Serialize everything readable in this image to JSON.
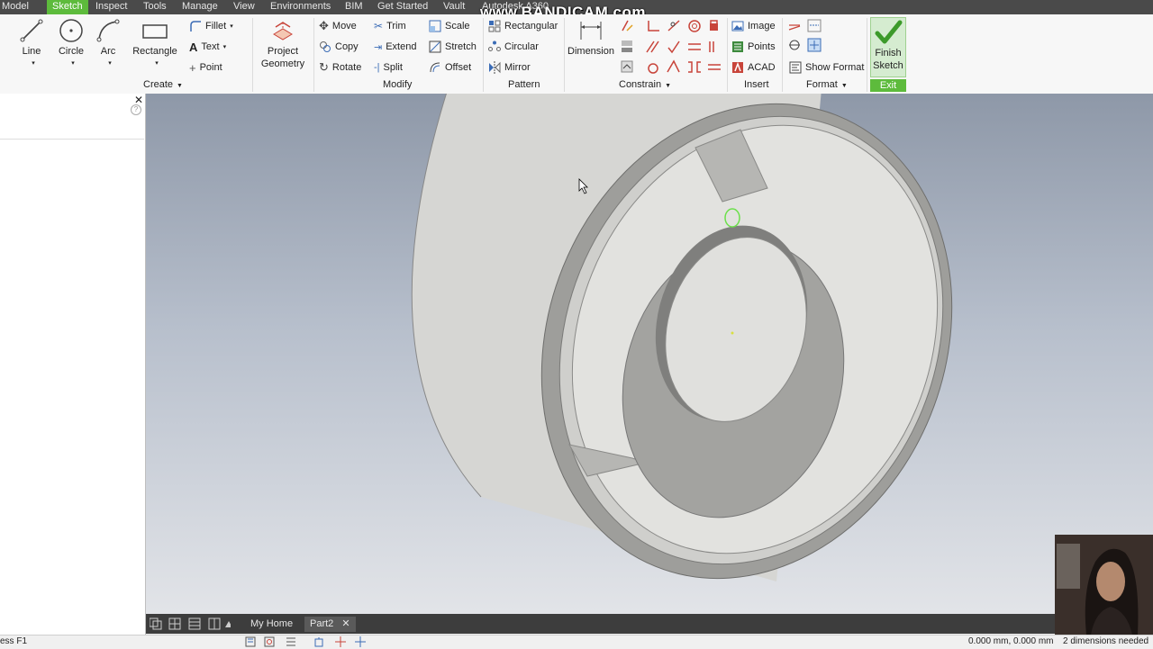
{
  "menubar": {
    "items": [
      "Model",
      "Sketch",
      "Inspect",
      "Tools",
      "Manage",
      "View",
      "Environments",
      "BIM",
      "Get Started",
      "Vault",
      "Autodesk A360"
    ],
    "active": "Sketch"
  },
  "watermark": "www.BANDICAM.com",
  "ribbon": {
    "create": {
      "line": "Line",
      "circle": "Circle",
      "arc": "Arc",
      "rectangle": "Rectangle",
      "fillet": "Fillet",
      "text": "Text",
      "point": "Point",
      "label": "Create"
    },
    "project_geometry": [
      "Project",
      "Geometry"
    ],
    "modify": {
      "move": "Move",
      "copy": "Copy",
      "rotate": "Rotate",
      "trim": "Trim",
      "extend": "Extend",
      "split": "Split",
      "scale": "Scale",
      "stretch": "Stretch",
      "offset": "Offset",
      "label": "Modify"
    },
    "pattern": {
      "rectangular": "Rectangular",
      "circular": "Circular",
      "mirror": "Mirror",
      "label": "Pattern"
    },
    "constrain": {
      "dimension": "Dimension",
      "label": "Constrain"
    },
    "insert": {
      "image": "Image",
      "points": "Points",
      "acad": "ACAD",
      "label": "Insert"
    },
    "format": {
      "show_format": "Show Format",
      "label": "Format"
    },
    "exit": {
      "finish": [
        "Finish",
        "Sketch"
      ],
      "label": "Exit"
    }
  },
  "tabs": {
    "home": "My Home",
    "part": "Part2",
    "close": "✕"
  },
  "status": {
    "left": "ess F1",
    "coords": "0.000 mm, 0.000 mm",
    "dims": "2 dimensions needed"
  },
  "colors": {
    "accent": "#5dbb3c",
    "menubar": "#4a4a4a",
    "tabbar": "#3d3d3d",
    "model": "#d4d4d0"
  }
}
